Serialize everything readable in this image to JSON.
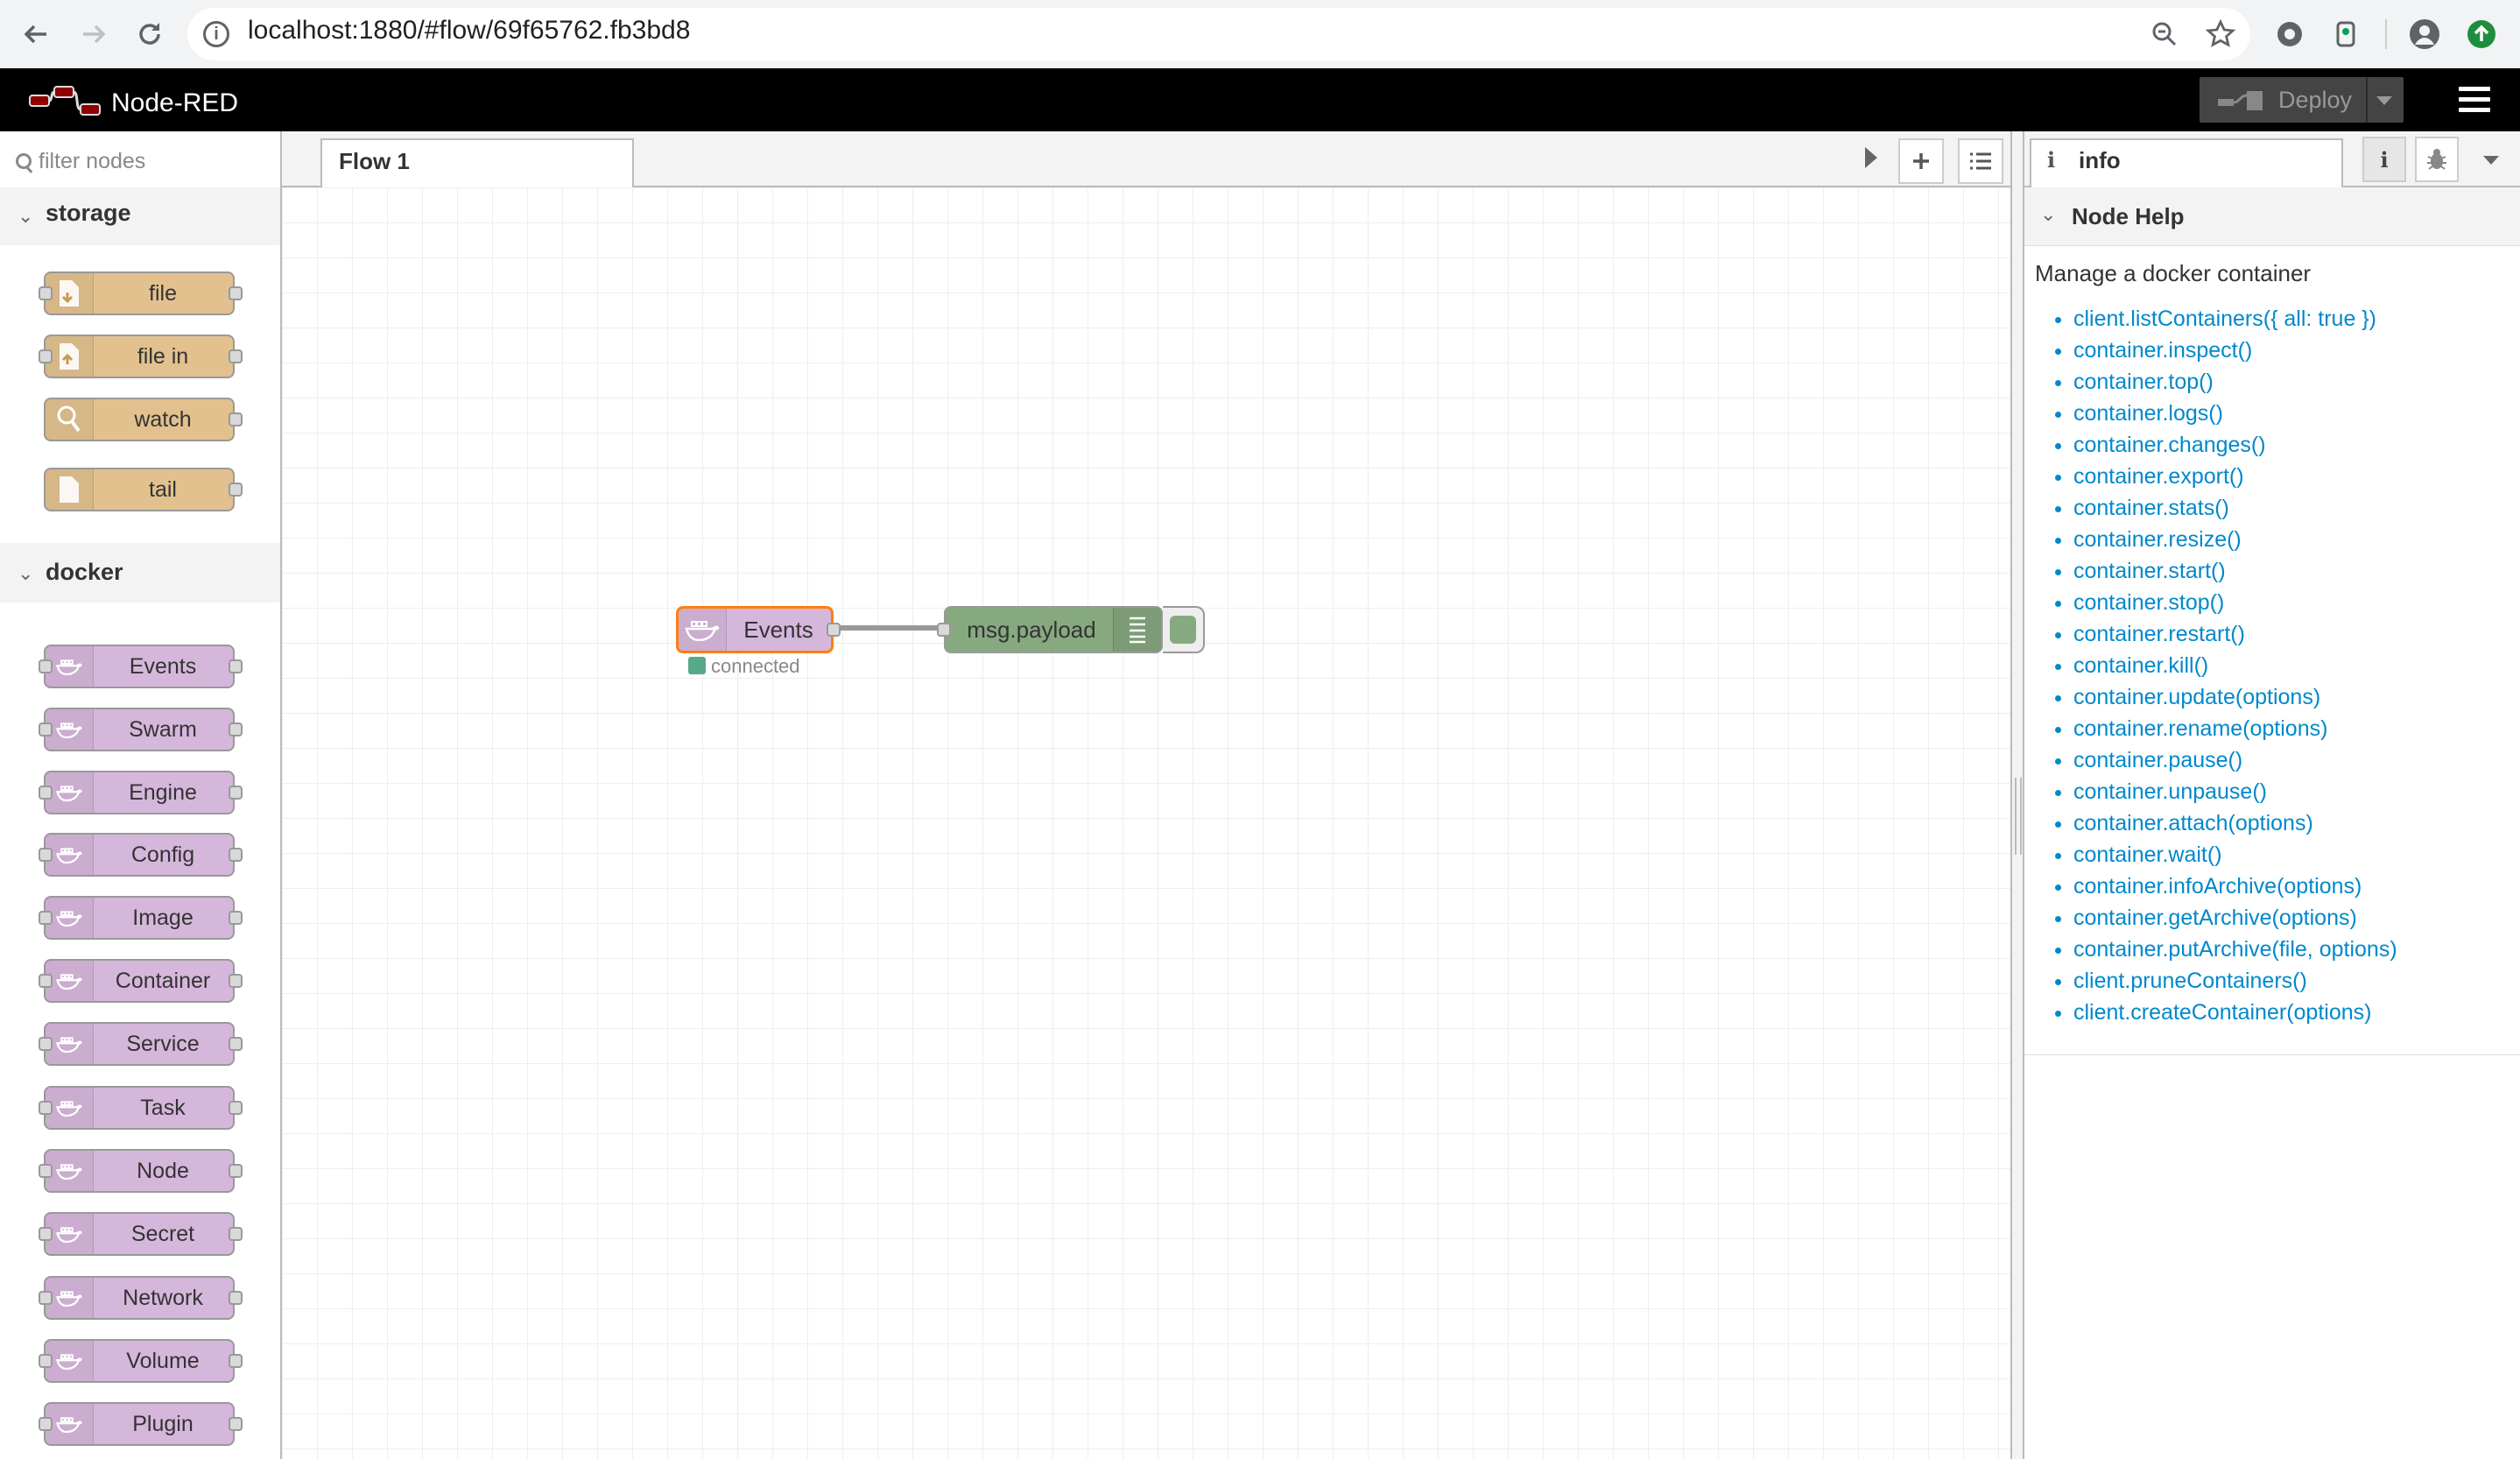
{
  "browser": {
    "url": "localhost:1880/#flow/69f65762.fb3bd8"
  },
  "header": {
    "app_title": "Node-RED",
    "deploy_label": "Deploy"
  },
  "palette": {
    "filter_placeholder": "filter nodes",
    "categories": [
      {
        "name": "storage",
        "nodes": [
          "file",
          "file in",
          "watch",
          "tail"
        ]
      },
      {
        "name": "docker",
        "nodes": [
          "Events",
          "Swarm",
          "Engine",
          "Config",
          "Image",
          "Container",
          "Service",
          "Task",
          "Node",
          "Secret",
          "Network",
          "Volume",
          "Plugin"
        ]
      }
    ]
  },
  "workspace": {
    "tab_label": "Flow 1",
    "nodes": {
      "events": {
        "label": "Events",
        "status": "connected"
      },
      "debug": {
        "label": "msg.payload"
      }
    }
  },
  "sidebar": {
    "tab_label": "info",
    "section_title": "Node Help",
    "description": "Manage a docker container",
    "methods": [
      "client.listContainers({ all: true })",
      "container.inspect()",
      "container.top()",
      "container.logs()",
      "container.changes()",
      "container.export()",
      "container.stats()",
      "container.resize()",
      "container.start()",
      "container.stop()",
      "container.restart()",
      "container.kill()",
      "container.update(options)",
      "container.rename(options)",
      "container.pause()",
      "container.unpause()",
      "container.attach(options)",
      "container.wait()",
      "container.infoArchive(options)",
      "container.getArchive(options)",
      "container.putArchive(file, options)",
      "client.pruneContainers()",
      "client.createContainer(options)"
    ]
  },
  "colors": {
    "header_bg": "#000000",
    "storage_node": "#e2c18f",
    "docker_node": "#d6b7dc",
    "debug_node": "#87a980",
    "selected_outline": "#ff7f0e",
    "link": "#0088cc"
  }
}
